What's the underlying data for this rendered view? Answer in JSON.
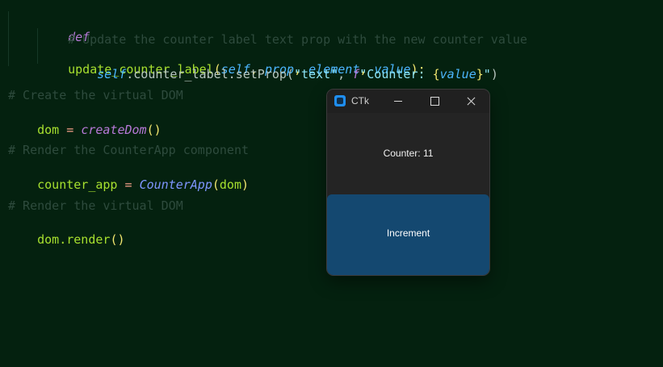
{
  "editor": {
    "line1": {
      "kw": "def",
      "fn": "update_counter_label",
      "open": "(",
      "self": "self",
      "c1": ", ",
      "p1": "prop",
      "c2": ", ",
      "p2": "element",
      "c3": ", ",
      "p3": "value",
      "close": "):"
    },
    "line2": "# Update the counter label text prop with the new counter value",
    "line3": {
      "self": "self",
      "call": ".counter_label.setProp(",
      "str1": "\"text\"",
      "comma": ", ",
      "fpre": "f",
      "str2a": "\"Counter: ",
      "lb": "{",
      "val": "value",
      "rb": "}",
      "str2b": "\"",
      "end": ")"
    },
    "line4": "# Create the virtual DOM",
    "line5": {
      "var": "dom",
      "op": " = ",
      "call": "createDom",
      "paren": "()"
    },
    "line6": "# Render the CounterApp component",
    "line7": {
      "var": "counter_app",
      "op": " = ",
      "cls": "CounterApp",
      "paren_open": "(",
      "arg": "dom",
      "paren_close": ")"
    },
    "line8": "# Render the virtual DOM",
    "line9": {
      "obj": "dom",
      "method": ".render",
      "paren": "()"
    }
  },
  "window": {
    "title": "CTk",
    "counter_label": "Counter: 11",
    "button_label": "Increment",
    "colors": {
      "window_bg": "#242424",
      "button": "#144870"
    }
  },
  "icons": {
    "app": "ctk-app-icon",
    "minimize": "minimize-icon",
    "maximize": "maximize-icon",
    "close": "close-icon"
  }
}
